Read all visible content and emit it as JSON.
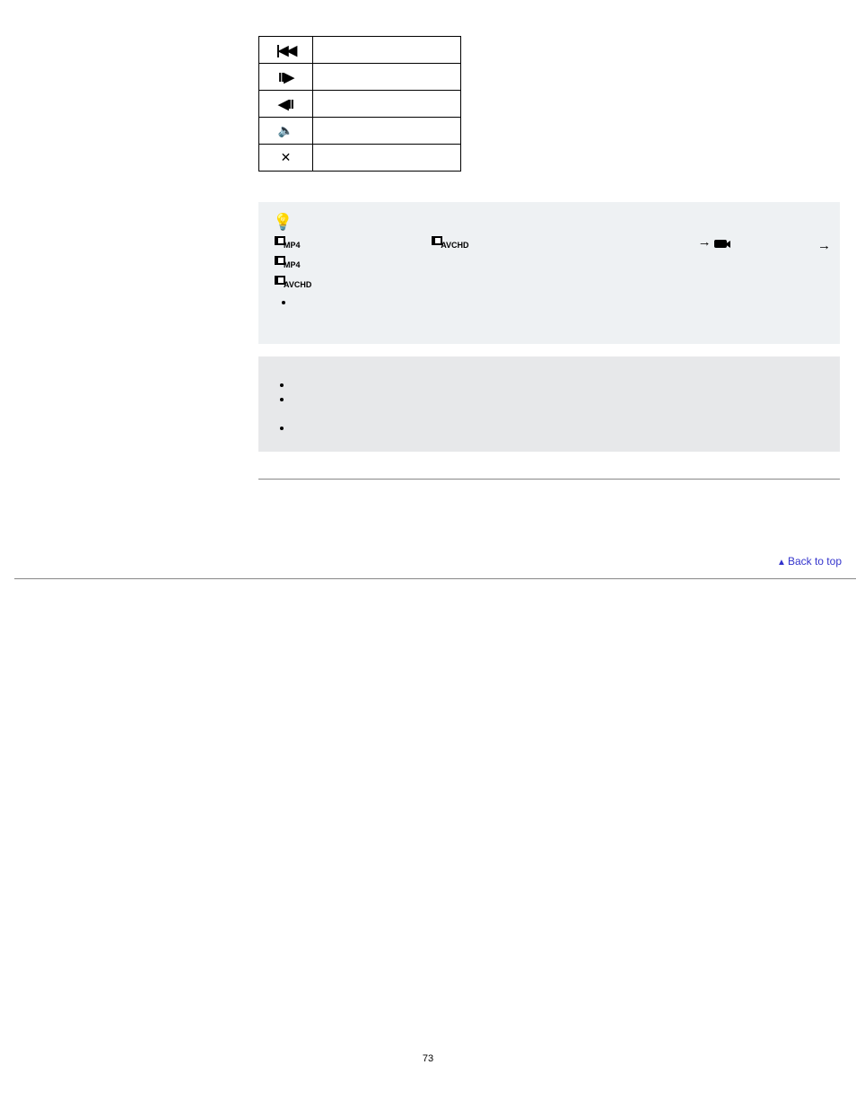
{
  "table": {
    "rows": [
      {
        "icon": "prev",
        "label": ""
      },
      {
        "icon": "slowfwd",
        "label": ""
      },
      {
        "icon": "slowrev",
        "label": ""
      },
      {
        "icon": "speaker",
        "label": ""
      },
      {
        "icon": "close",
        "label": ""
      }
    ]
  },
  "hint": {
    "tag_mp4": "MP4",
    "tag_avchd": "AVCHD",
    "bullets": [
      ""
    ]
  },
  "notes": {
    "bullets": [
      "",
      "",
      ""
    ]
  },
  "back_link": "Back to top",
  "page_number": "73"
}
